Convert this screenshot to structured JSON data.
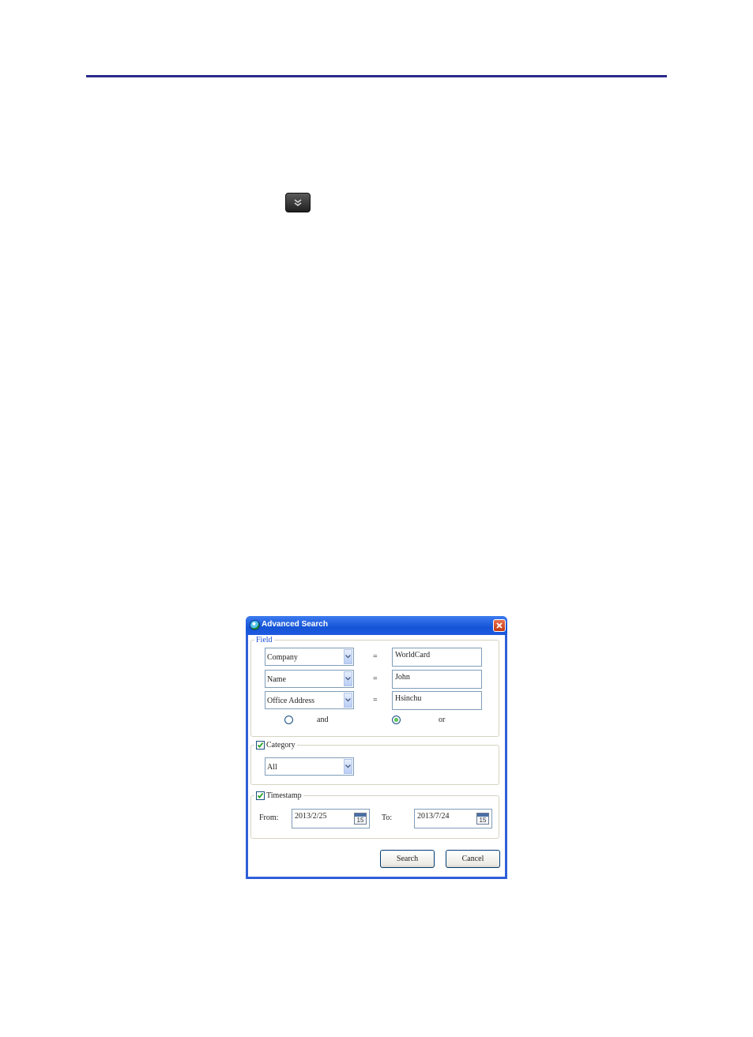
{
  "dialog": {
    "title": "Advanced Search",
    "field_group": {
      "legend": "Field",
      "rows": [
        {
          "field": "Company",
          "operator": "=",
          "value": "WorldCard"
        },
        {
          "field": "Name",
          "operator": "=",
          "value": "John"
        },
        {
          "field": "Office Address",
          "operator": "=",
          "value": "Hsinchu"
        }
      ],
      "logic": {
        "and_label": "and",
        "or_label": "or",
        "selected": "or"
      }
    },
    "category_group": {
      "legend": "Category",
      "checked": true,
      "value": "All"
    },
    "timestamp_group": {
      "legend": "Timestamp",
      "checked": true,
      "from_label": "From:",
      "from_value": "2013/2/25",
      "to_label": "To:",
      "to_value": "2013/7/24",
      "calendar_day": "15"
    },
    "buttons": {
      "search": "Search",
      "cancel": "Cancel"
    }
  },
  "colors": {
    "rule": "#2a2a8c",
    "titlebar": "#1554d6",
    "legend_field": "#1b4fd6"
  },
  "icons": {
    "expand_button": "double-chevron-down-icon",
    "dialog_icon": "worldcard-globe-icon",
    "close": "close-icon",
    "calendar": "calendar-icon"
  }
}
